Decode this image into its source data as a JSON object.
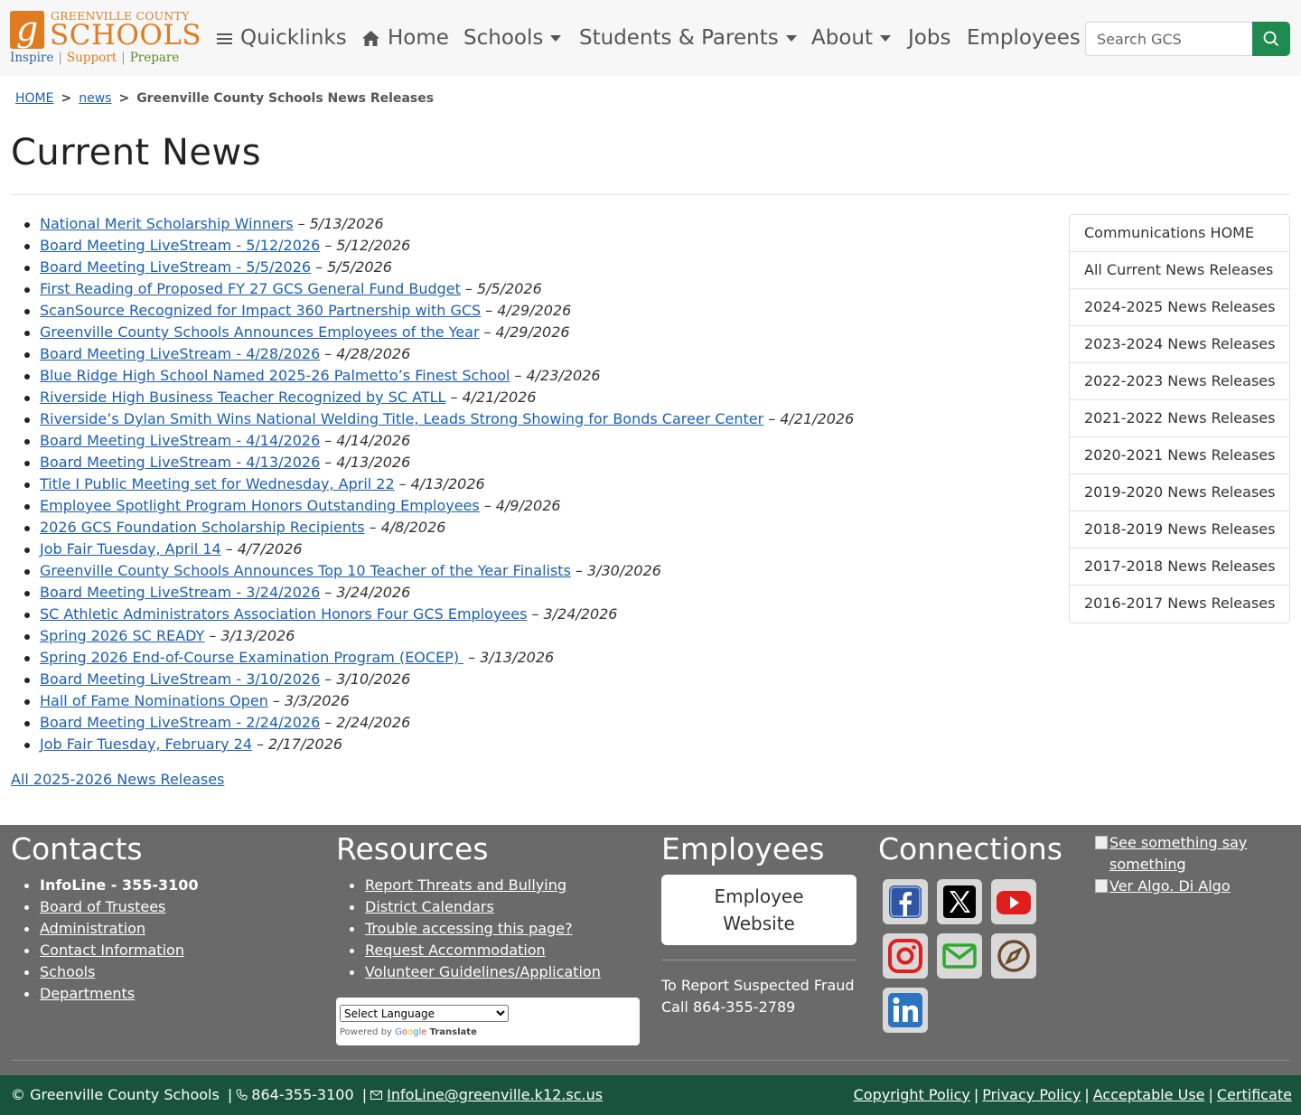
{
  "header": {
    "logo": {
      "county": "GREENVILLE COUNTY",
      "schools": "SCHOOLS",
      "tag1": "Inspire",
      "tag2": "Support",
      "tag3": "Prepare"
    },
    "nav": {
      "quicklinks": "Quicklinks",
      "home": "Home",
      "schools": "Schools",
      "students_parents": "Students & Parents",
      "about": "About",
      "jobs": "Jobs",
      "employees": "Employees"
    },
    "search": {
      "placeholder": "Search GCS"
    }
  },
  "breadcrumb": {
    "home": "HOME",
    "news": "news",
    "current": "Greenville County Schools News Releases",
    "separator": ">"
  },
  "page_title": "Current News",
  "news": [
    {
      "title": "National Merit Scholarship Winners",
      "date": "5/13/2026"
    },
    {
      "title": "Board Meeting LiveStream - 5/12/2026",
      "date": "5/12/2026"
    },
    {
      "title": "Board Meeting LiveStream - 5/5/2026",
      "date": "5/5/2026"
    },
    {
      "title": "First Reading of Proposed FY 27 GCS General Fund Budget",
      "date": "5/5/2026"
    },
    {
      "title": "ScanSource Recognized for Impact 360 Partnership with GCS",
      "date": "4/29/2026"
    },
    {
      "title": "Greenville County Schools Announces Employees of the Year",
      "date": "4/29/2026"
    },
    {
      "title": "Board Meeting LiveStream - 4/28/2026",
      "date": "4/28/2026"
    },
    {
      "title": "Blue Ridge High School Named 2025-26 Palmetto’s Finest School",
      "date": "4/23/2026"
    },
    {
      "title": "Riverside High Business Teacher Recognized by SC ATLL",
      "date": "4/21/2026"
    },
    {
      "title": "Riverside’s Dylan Smith Wins National Welding Title, Leads Strong Showing for Bonds Career Center",
      "date": "4/21/2026"
    },
    {
      "title": "Board Meeting LiveStream - 4/14/2026",
      "date": "4/14/2026"
    },
    {
      "title": "Board Meeting LiveStream - 4/13/2026",
      "date": "4/13/2026"
    },
    {
      "title": "Title I Public Meeting set for Wednesday, April 22",
      "date": "4/13/2026"
    },
    {
      "title": "Employee Spotlight Program Honors Outstanding Employees",
      "date": "4/9/2026"
    },
    {
      "title": "2026 GCS Foundation Scholarship Recipients",
      "date": "4/8/2026"
    },
    {
      "title": "Job Fair Tuesday, April 14",
      "date": "4/7/2026"
    },
    {
      "title": "Greenville County Schools Announces Top 10 Teacher of the Year Finalists",
      "date": "3/30/2026"
    },
    {
      "title": "Board Meeting LiveStream - 3/24/2026",
      "date": "3/24/2026"
    },
    {
      "title": "SC Athletic Administrators Association Honors Four GCS Employees",
      "date": "3/24/2026"
    },
    {
      "title": "Spring 2026 SC READY",
      "date": "3/13/2026"
    },
    {
      "title": "Spring 2026 End-of-Course Examination Program (EOCEP) ",
      "date": "3/13/2026"
    },
    {
      "title": "Board Meeting LiveStream - 3/10/2026",
      "date": "3/10/2026"
    },
    {
      "title": "Hall of Fame Nominations Open",
      "date": "3/3/2026"
    },
    {
      "title": "Board Meeting LiveStream - 2/24/2026",
      "date": "2/24/2026"
    },
    {
      "title": "Job Fair Tuesday, February 24",
      "date": "2/17/2026"
    }
  ],
  "news_separator": "–",
  "all_news_link": "All 2025-2026 News Releases",
  "sidebar": [
    "Communications HOME",
    "All Current News Releases",
    "2024-2025 News Releases",
    "2023-2024 News Releases",
    "2022-2023 News Releases",
    "2021-2022 News Releases",
    "2020-2021 News Releases",
    "2019-2020 News Releases",
    "2018-2019 News Releases",
    "2017-2018 News Releases",
    "2016-2017 News Releases"
  ],
  "footer": {
    "contacts": {
      "heading": "Contacts",
      "infoline": "InfoLine - 355-3100",
      "links": [
        "Board of Trustees",
        "Administration",
        "Contact Information",
        "Schools",
        "Departments"
      ]
    },
    "resources": {
      "heading": "Resources",
      "links": [
        "Report Threats and Bullying",
        "District Calendars",
        "Trouble accessing this page?",
        "Request Accommodation",
        "Volunteer Guidelines/Application"
      ],
      "translate_select": "Select Language",
      "powered_by": "Powered by",
      "google": [
        "G",
        "o",
        "o",
        "g",
        "l",
        "e"
      ],
      "translate_word": "Translate"
    },
    "employees": {
      "heading": "Employees",
      "button_line1": "Employee",
      "button_line2": "Website",
      "fraud_line1": "To Report Suspected Fraud",
      "fraud_line2": "Call 864-355-2789"
    },
    "connections": {
      "heading": "Connections",
      "icons": [
        "facebook-icon",
        "x-icon",
        "youtube-icon",
        "instagram-icon",
        "email-icon",
        "compass-icon",
        "linkedin-icon"
      ]
    },
    "see_something": {
      "alt1": "See something say something",
      "alt2": "Ver Algo. Di Algo"
    }
  },
  "bottom_bar": {
    "copyright": "© Greenville County Schools",
    "phone": "864-355-3100",
    "email": "InfoLine@greenville.k12.sc.us",
    "separator": "|",
    "links": [
      "Copyright Policy",
      "Privacy Policy",
      "Acceptable Use",
      "Certificate"
    ]
  },
  "colors": {
    "brand_orange": "#e07b1f",
    "brand_blue": "#2c64a8",
    "brand_green": "#5a8f2a",
    "search_button": "#1f8a50",
    "footer_gray": "#6a6a6a",
    "bottom_bar_green": "#17543b",
    "link_blue": "#1a5fb4"
  }
}
